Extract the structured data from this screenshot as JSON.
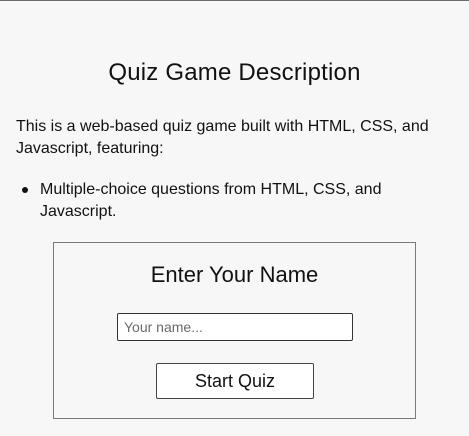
{
  "page": {
    "title": "Quiz Game Description",
    "intro": "This is a web-based quiz game built with HTML, CSS, and Javascript, featuring:",
    "features": [
      "Multiple-choice questions from HTML, CSS, and Javascript."
    ]
  },
  "name_form": {
    "title": "Enter Your Name",
    "name_placeholder": "Your name...",
    "name_value": "",
    "start_label": "Start Quiz"
  }
}
